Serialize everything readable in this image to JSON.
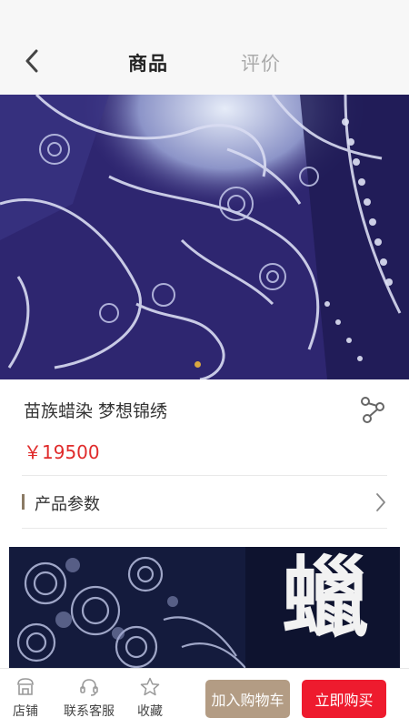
{
  "nav": {
    "tabs": [
      {
        "label": "商品",
        "active": true
      },
      {
        "label": "评价",
        "active": false
      }
    ]
  },
  "product": {
    "title": "苗族蜡染 梦想锦绣",
    "price": "￥19500",
    "params_label": "产品参数"
  },
  "banner": {
    "glyph": "蠟"
  },
  "bottom_bar": {
    "items": [
      {
        "label": "店铺",
        "icon": "shop-icon"
      },
      {
        "label": "联系客服",
        "icon": "headset-icon"
      },
      {
        "label": "收藏",
        "icon": "star-icon"
      }
    ],
    "add_to_cart": "加入购物车",
    "buy_now": "立即购买"
  },
  "colors": {
    "price": "#e02b2b",
    "buy_button": "#ee1b2e",
    "cart_button": "#b39c84",
    "carousel_dot": "#d9a741",
    "section_bar": "#8b7a64"
  }
}
